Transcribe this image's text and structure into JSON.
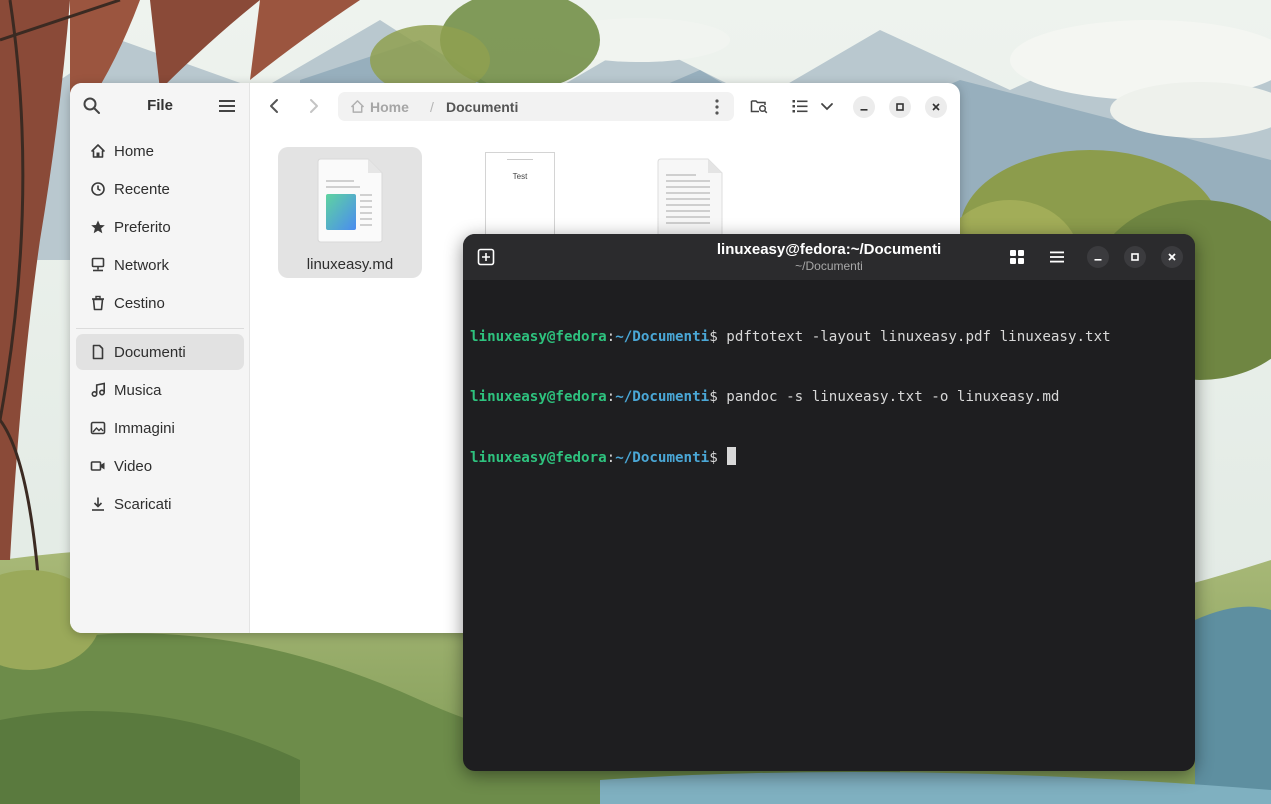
{
  "wallpaper": {
    "name": "illustrated-forest-wallpaper"
  },
  "file_manager": {
    "sidebar": {
      "title": "File",
      "places": [
        {
          "label": "Home",
          "icon": "home-icon"
        },
        {
          "label": "Recente",
          "icon": "clock-icon"
        },
        {
          "label": "Preferito",
          "icon": "star-icon"
        },
        {
          "label": "Network",
          "icon": "network-icon"
        },
        {
          "label": "Cestino",
          "icon": "trash-icon"
        }
      ],
      "bookmarks": [
        {
          "label": "Documenti",
          "icon": "document-icon",
          "active": true
        },
        {
          "label": "Musica",
          "icon": "music-icon"
        },
        {
          "label": "Immagini",
          "icon": "image-icon"
        },
        {
          "label": "Video",
          "icon": "video-icon"
        },
        {
          "label": "Scaricati",
          "icon": "download-icon"
        }
      ]
    },
    "pathbar": {
      "home": "Home",
      "separator": "/",
      "current": "Documenti"
    },
    "files": [
      {
        "name": "linuxeasy.md",
        "icon": "markdown-file-icon",
        "selected": true
      },
      {
        "name": "",
        "icon": "pdf-thumbnail",
        "thumb_text": "Test"
      },
      {
        "name": "",
        "icon": "text-file-icon"
      }
    ]
  },
  "terminal": {
    "title": "linuxeasy@fedora:~/Documenti",
    "subtitle": "~/Documenti",
    "lines": [
      {
        "user": "linuxeasy@fedora",
        "colon": ":",
        "path": "~/Documenti",
        "symbol": "$",
        "command": " pdftotext -layout linuxeasy.pdf linuxeasy.txt"
      },
      {
        "user": "linuxeasy@fedora",
        "colon": ":",
        "path": "~/Documenti",
        "symbol": "$",
        "command": " pandoc -s linuxeasy.txt -o linuxeasy.md"
      },
      {
        "user": "linuxeasy@fedora",
        "colon": ":",
        "path": "~/Documenti",
        "symbol": "$",
        "command": " "
      }
    ]
  },
  "colors": {
    "terminal_bg": "#1e1e20",
    "prompt_user": "#2ec27e",
    "prompt_path": "#4aa7d6",
    "sidebar_active": "#e2e2e2"
  }
}
